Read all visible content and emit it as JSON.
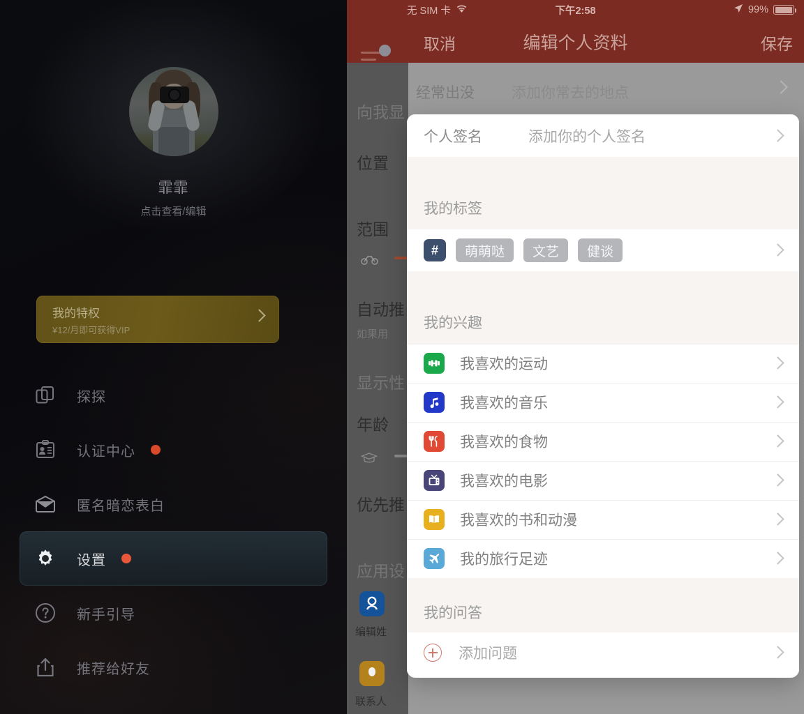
{
  "drawer": {
    "profile": {
      "name": "霏霏",
      "subtitle": "点击查看/编辑",
      "avatar_icon": "user-photo-avatar"
    },
    "vip_card": {
      "title": "我的特权",
      "subtitle": "¥12/月即可获得VIP",
      "chevron_icon": "chevron-right-icon"
    },
    "menu": [
      {
        "label": "探探",
        "icon": "cards-stack-icon",
        "badge": false,
        "active": false
      },
      {
        "label": "认证中心",
        "icon": "id-card-icon",
        "badge": true,
        "active": false
      },
      {
        "label": "匿名暗恋表白",
        "icon": "envelope-icon",
        "badge": false,
        "active": false
      },
      {
        "label": "设置",
        "icon": "gear-icon",
        "badge": true,
        "active": true
      },
      {
        "label": "新手引导",
        "icon": "question-circle-icon",
        "badge": false,
        "active": false
      },
      {
        "label": "推荐给好友",
        "icon": "share-upload-icon",
        "badge": false,
        "active": false
      }
    ]
  },
  "phone": {
    "statusbar": {
      "carrier": "无 SIM 卡",
      "wifi_icon": "wifi-icon",
      "time": "下午2:58",
      "location_icon": "location-arrow-icon",
      "battery_percent": "99%",
      "battery_icon": "battery-icon"
    },
    "navbar": {
      "menu_icon": "hamburger-filter-icon",
      "cancel": "取消",
      "title": "编辑个人资料",
      "save": "保存"
    },
    "background_rows": [
      {
        "label": "经常出没",
        "value": "添加你常去的地点",
        "chevron_icon": "chevron-right-icon"
      }
    ],
    "background_left_labels": [
      "向我显",
      "位置",
      "范围",
      "自动推",
      "如果用",
      "显示性",
      "年龄",
      "优先推",
      "应用设",
      "编辑姓",
      "联系人"
    ],
    "background_icons": [
      {
        "name": "bicycle-icon"
      },
      {
        "name": "graduation-cap-icon"
      },
      {
        "name": "contacts-app-icon",
        "color": "#14539a"
      },
      {
        "name": "privacy-app-icon",
        "color": "#b4821c"
      }
    ]
  },
  "modal": {
    "signature_row": {
      "label": "个人签名",
      "value": "添加你的个人签名",
      "chevron_icon": "chevron-right-icon"
    },
    "tags_section": {
      "heading": "我的标签",
      "hash_icon": "hash-icon",
      "tags": [
        "萌萌哒",
        "文艺",
        "健谈"
      ],
      "chevron_icon": "chevron-right-icon"
    },
    "interests_section": {
      "heading": "我的兴趣",
      "items": [
        {
          "label": "我喜欢的运动",
          "icon": "dumbbell-icon",
          "color": "#1aa84a"
        },
        {
          "label": "我喜欢的音乐",
          "icon": "music-note-icon",
          "color": "#2238c8"
        },
        {
          "label": "我喜欢的食物",
          "icon": "utensils-icon",
          "color": "#e04a35"
        },
        {
          "label": "我喜欢的电影",
          "icon": "television-icon",
          "color": "#4a4579"
        },
        {
          "label": "我喜欢的书和动漫",
          "icon": "open-book-icon",
          "color": "#e8b01e"
        },
        {
          "label": "我的旅行足迹",
          "icon": "airplane-icon",
          "color": "#59a8d8"
        }
      ]
    },
    "qa_section": {
      "heading": "我的问答",
      "add_label": "添加问题",
      "add_icon": "plus-circle-icon",
      "chevron_icon": "chevron-right-icon"
    }
  },
  "colors": {
    "nav_bar": "#7b2b22",
    "drawer_bg": "#0b0c10",
    "vip_gold": "#635218",
    "badge_red": "#d94a2b",
    "tag_gray": "#b4b6b9",
    "hash_navy": "#3c4f6d"
  }
}
